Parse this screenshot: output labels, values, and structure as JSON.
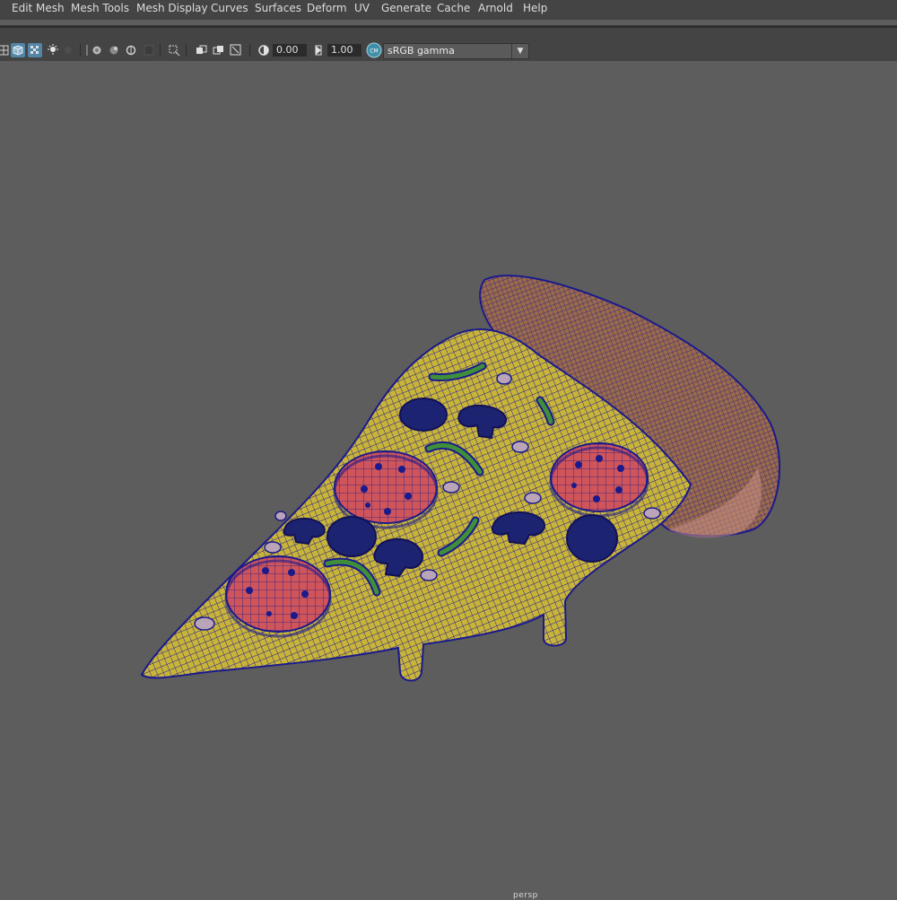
{
  "menu": [
    "Edit Mesh",
    "Mesh Tools",
    "Mesh Display",
    "Curves",
    "Surfaces",
    "Deform",
    "UV",
    "Generate",
    "Cache",
    "Arnold",
    "Help"
  ],
  "toolbar": {
    "icons": [
      "wireframe-on-shaded-icon",
      "shaded-icon",
      "textured-icon",
      "lights-icon",
      "shadows-icon",
      "ambient-occlusion-icon",
      "xray-icon",
      "xray-joints-icon",
      "isolate-select-icon",
      "grid-icon",
      "gate-mask-icon",
      "resolution-gate-icon",
      "field-chart-icon",
      "safe-action-icon",
      "exposure-icon",
      "gamma-icon",
      "color-management-icon"
    ],
    "exposure_value": "0.00",
    "gamma_value": "1.00",
    "color_management_badge": "CM",
    "colorspace": "sRGB gamma"
  },
  "viewport": {
    "camera_label": "persp",
    "background_color": "#5d5d5d",
    "wire_color": "#1a1a8c",
    "cheese_color": "#c9b43a",
    "crust_color": "#9b6a4a",
    "pepperoni_color": "#d0555a",
    "pepper_color": "#3f8f3a",
    "olive_mushroom_color": "#1c2370"
  }
}
